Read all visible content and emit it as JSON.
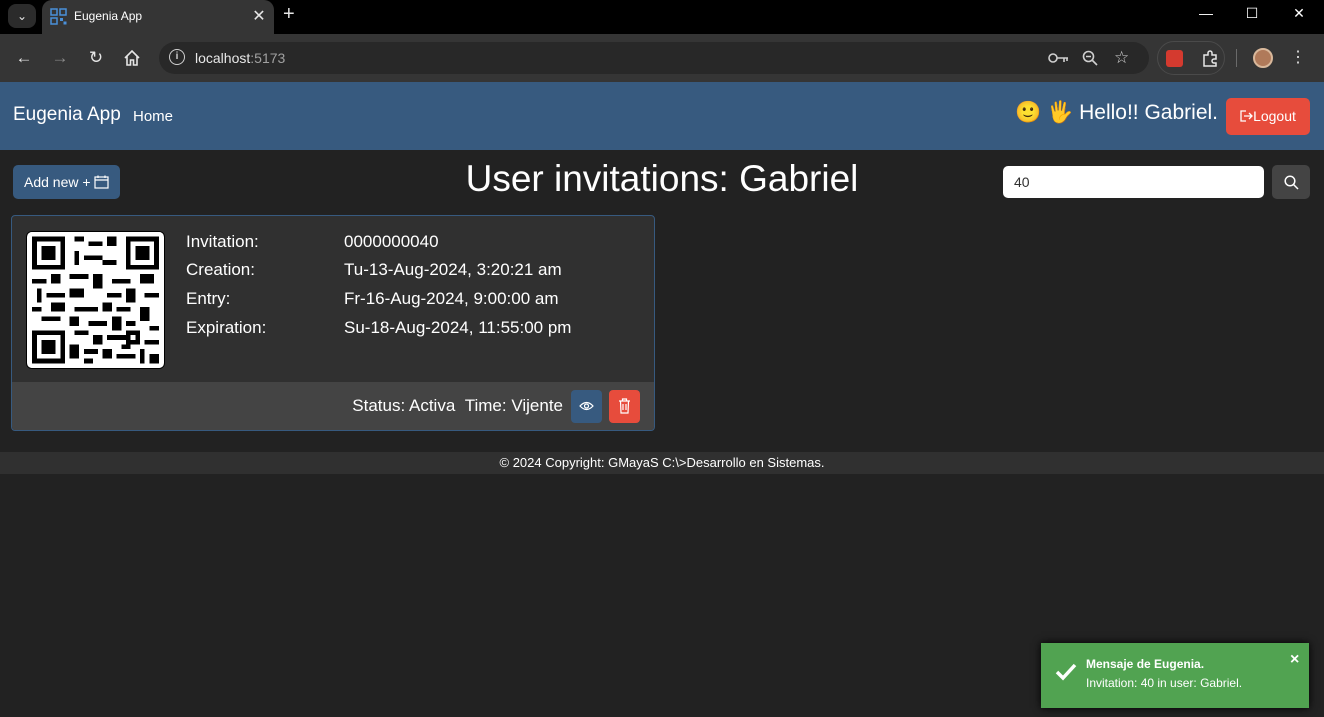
{
  "browser": {
    "tab_title": "Eugenia App",
    "tab_close": "✕",
    "new_tab": "+",
    "url_host": "localhost",
    "url_port": ":5173"
  },
  "navbar": {
    "brand": "Eugenia App",
    "home_link": "Home",
    "greeting_emoji": "🙂 🖐",
    "greeting": "Hello!! Gabriel.",
    "logout_label": "Logout"
  },
  "page": {
    "add_new_label": "Add new +",
    "title": "User invitations: Gabriel",
    "search_value": "40"
  },
  "invitation": {
    "labels": [
      "Invitation:",
      "Creation:",
      "Entry:",
      "Expiration:"
    ],
    "values": [
      "0000000040",
      "Tu-13-Aug-2024, 3:20:21 am",
      "Fr-16-Aug-2024, 9:00:00 am",
      "Su-18-Aug-2024, 11:55:00 pm"
    ],
    "status_label": "Status: Activa",
    "time_label": "Time: Vijente"
  },
  "footer": {
    "copyright": "© 2024 Copyright: GMayaS C:\\>Desarrollo en Sistemas."
  },
  "toast": {
    "title": "Mensaje de Eugenia.",
    "message": "Invitation: 40 in user: Gabriel.",
    "close": "×"
  },
  "colors": {
    "primary": "#375a7f",
    "danger": "#e74c3c",
    "success": "#51a351",
    "background": "#222222"
  }
}
